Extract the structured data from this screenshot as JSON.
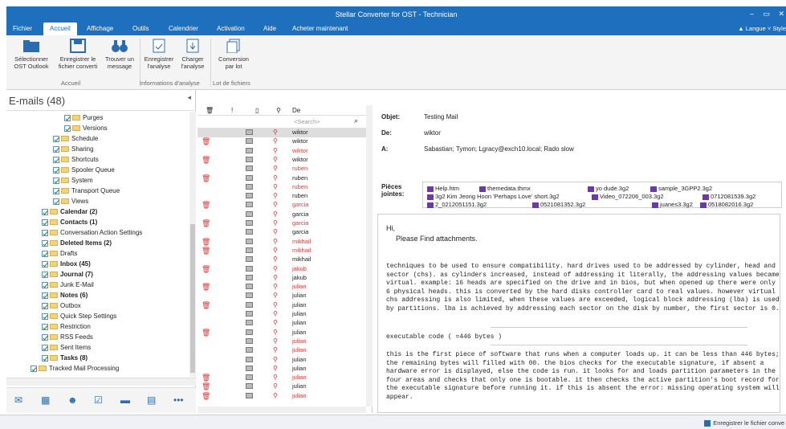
{
  "title": "Stellar Converter for OST - Technician",
  "menu": {
    "tabs": [
      "Fichier",
      "Accueil",
      "Affichage",
      "Outils",
      "Calendrier",
      "Activation",
      "Aide",
      "Acheter maintenant"
    ],
    "right": "▲ Langue  ˅ Style"
  },
  "ribbon": {
    "buttons": [
      [
        "Sélectionner",
        "OST Outlook"
      ],
      [
        "Enregistrer le",
        "fichier converti"
      ],
      [
        "Trouver un",
        "message"
      ],
      [
        "Enregistrer",
        "l'analyse"
      ],
      [
        "Charger",
        "l'analyse"
      ],
      [
        "Conversion",
        "par lot"
      ]
    ],
    "groups": [
      "Accueil",
      "Informations d'analyse",
      "Lot de fichiers"
    ]
  },
  "left": {
    "header": "E-mails (48)",
    "tree": [
      {
        "t": "Purges",
        "l": 3,
        "b": false
      },
      {
        "t": "Versions",
        "l": 3,
        "b": false
      },
      {
        "t": "Schedule",
        "l": 2,
        "b": false
      },
      {
        "t": "Sharing",
        "l": 2,
        "b": false
      },
      {
        "t": "Shortcuts",
        "l": 2,
        "b": false
      },
      {
        "t": "Spooler Queue",
        "l": 2,
        "b": false
      },
      {
        "t": "System",
        "l": 2,
        "b": false
      },
      {
        "t": "Transport Queue",
        "l": 2,
        "b": false
      },
      {
        "t": "Views",
        "l": 2,
        "b": false
      },
      {
        "t": "Calendar (2)",
        "l": 1,
        "b": true
      },
      {
        "t": "Contacts (1)",
        "l": 1,
        "b": true
      },
      {
        "t": "Conversation Action Settings",
        "l": 1,
        "b": false
      },
      {
        "t": "Deleted Items (2)",
        "l": 1,
        "b": true
      },
      {
        "t": "Drafts",
        "l": 1,
        "b": false
      },
      {
        "t": "Inbox (45)",
        "l": 1,
        "b": true
      },
      {
        "t": "Journal (7)",
        "l": 1,
        "b": true
      },
      {
        "t": "Junk E-Mail",
        "l": 1,
        "b": false
      },
      {
        "t": "Notes (6)",
        "l": 1,
        "b": true
      },
      {
        "t": "Outbox",
        "l": 1,
        "b": false
      },
      {
        "t": "Quick Step Settings",
        "l": 1,
        "b": false
      },
      {
        "t": "Restriction",
        "l": 1,
        "b": false
      },
      {
        "t": "RSS Feeds",
        "l": 1,
        "b": false
      },
      {
        "t": "Sent Items",
        "l": 1,
        "b": false
      },
      {
        "t": "Tasks (8)",
        "l": 1,
        "b": true
      },
      {
        "t": "Tracked Mail Processing",
        "l": 0,
        "b": false
      }
    ],
    "nav": [
      "mail-icon",
      "calendar-icon",
      "contacts-icon",
      "tasks-icon",
      "notes-icon",
      "journal-icon",
      "more-icon"
    ]
  },
  "list": {
    "headers": [
      "De"
    ],
    "search": "<Search>",
    "rows": [
      {
        "f": "wiktor",
        "u": false,
        "d": false,
        "s": true
      },
      {
        "f": "wiktor",
        "u": false,
        "d": true,
        "s": false
      },
      {
        "f": "wiktor",
        "u": true,
        "d": false,
        "s": false
      },
      {
        "f": "wiktor",
        "u": false,
        "d": true,
        "s": false
      },
      {
        "f": "ruben",
        "u": true,
        "d": false,
        "s": false
      },
      {
        "f": "ruben",
        "u": false,
        "d": true,
        "s": false
      },
      {
        "f": "ruben",
        "u": true,
        "d": false,
        "s": false
      },
      {
        "f": "ruben",
        "u": false,
        "d": false,
        "s": false
      },
      {
        "f": "garcia",
        "u": true,
        "d": true,
        "s": false
      },
      {
        "f": "garcia",
        "u": false,
        "d": false,
        "s": false
      },
      {
        "f": "garcia",
        "u": true,
        "d": true,
        "s": false
      },
      {
        "f": "garcia",
        "u": false,
        "d": false,
        "s": false
      },
      {
        "f": "mikhail",
        "u": true,
        "d": true,
        "s": false
      },
      {
        "f": "mikhail",
        "u": true,
        "d": true,
        "s": false
      },
      {
        "f": "mikhail",
        "u": false,
        "d": false,
        "s": false
      },
      {
        "f": "jakub",
        "u": true,
        "d": true,
        "s": false
      },
      {
        "f": "jakub",
        "u": false,
        "d": false,
        "s": false
      },
      {
        "f": "julian",
        "u": true,
        "d": true,
        "s": false
      },
      {
        "f": "julian",
        "u": false,
        "d": false,
        "s": false
      },
      {
        "f": "julian",
        "u": false,
        "d": true,
        "s": false
      },
      {
        "f": "julian",
        "u": false,
        "d": false,
        "s": false
      },
      {
        "f": "julian",
        "u": false,
        "d": false,
        "s": false
      },
      {
        "f": "julian",
        "u": false,
        "d": true,
        "s": false
      },
      {
        "f": "julian",
        "u": true,
        "d": false,
        "s": false
      },
      {
        "f": "julian",
        "u": true,
        "d": false,
        "s": false
      },
      {
        "f": "julian",
        "u": false,
        "d": false,
        "s": false
      },
      {
        "f": "julian",
        "u": false,
        "d": false,
        "s": false
      },
      {
        "f": "julian",
        "u": true,
        "d": true,
        "s": false
      },
      {
        "f": "julian",
        "u": false,
        "d": true,
        "s": false
      },
      {
        "f": "julian",
        "u": true,
        "d": true,
        "s": false
      }
    ]
  },
  "reading": {
    "subject_k": "Objet:",
    "subject": "Testing Mail",
    "from_k": "De:",
    "from": "wiktor",
    "to_k": "A:",
    "to": "Sabastian; Tymon; Lgracy@exch10.local; Rado slow",
    "att_k1": "Pièces",
    "att_k2": "jointes:",
    "attachments": [
      [
        "Help.htm",
        "themedata.thmx",
        "yo dude.3g2",
        "sample_3GPP2.3g2"
      ],
      [
        "3g2 Kim Jeong Hoon 'Perhaps Love' short.3g2",
        "Video_072206_003.3g2",
        "0712081539.3g2"
      ],
      [
        "2_0212051151.3g2",
        "0521081352.3g2",
        "juanes3.3g2",
        "0518082016.3g2"
      ]
    ],
    "hi": "Hi,",
    "please": "Please Find attachments.",
    "p1": "techniques to be used to ensure compatibility. hard drives used to be addressed by cylinder, head and sector (chs). as cylinders increased, instead of addressing it literally, the addressing values became virtual. example: 16 heads are specified on the drive and in bios, but when opened up there were only 6 physical heads. this is converted by the hard disks controller card to real values. however virtual chs addressing is also limited, when these values are exceeded, logical block addressing (lba) is used by partitions. lba is achieved by addressing each sector on the disk by number, the first sector is 0.",
    "p2": "executable code ( =446 bytes )",
    "p3": "this is the first piece of software that runs when a computer loads up. it can be less than 446 bytes; the remaining bytes will filled with 00. the bios checks for the executable signature, if absent a hardware error is displayed, else the code is run. it looks for and loads partition parameters in the four areas and checks that only one is bootable. it then checks the active partition's boot record for the executable signature before running it. if this is absent the error: missing operating system will appear."
  },
  "status": "Enregistrer le fichier conve"
}
